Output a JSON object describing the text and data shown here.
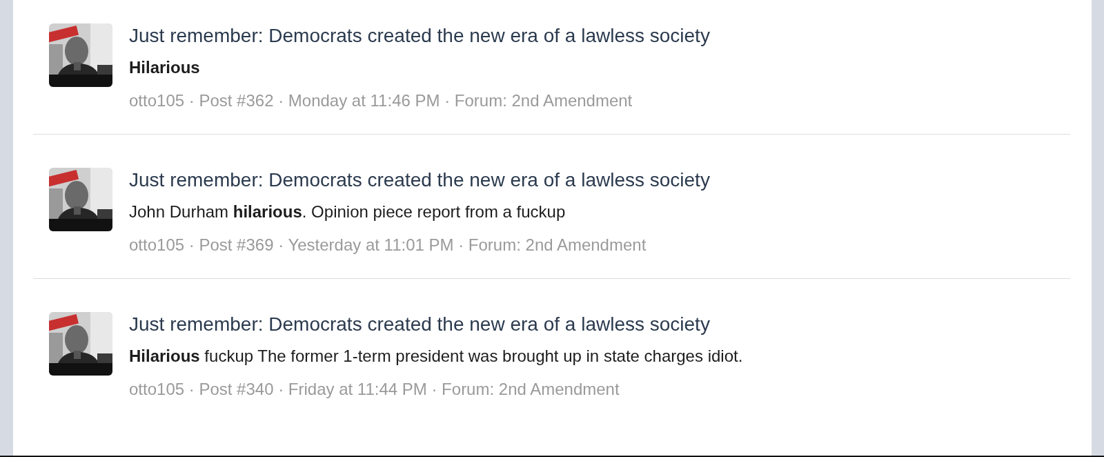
{
  "results": [
    {
      "title": "Just remember: Democrats created the new era of a lawless society",
      "snippet": "Hilarious",
      "snippet_bold": true,
      "meta": "otto105 · Post #362 · Monday at 11:46 PM · Forum: 2nd Amendment"
    },
    {
      "title": "Just remember: Democrats created the new era of a lawless society",
      "snippet": "John Durham **hilarious**. Opinion piece report from a fuckup",
      "snippet_bold": false,
      "meta": "otto105 · Post #369 · Yesterday at 11:01 PM · Forum: 2nd Amendment"
    },
    {
      "title": "Just remember: Democrats created the new era of a lawless society",
      "snippet": "**Hilarious** fuckup The former 1-term president was brought up in state charges idiot.",
      "snippet_bold": false,
      "meta": "otto105 · Post #340 · Friday at 11:44 PM · Forum: 2nd Amendment"
    }
  ]
}
